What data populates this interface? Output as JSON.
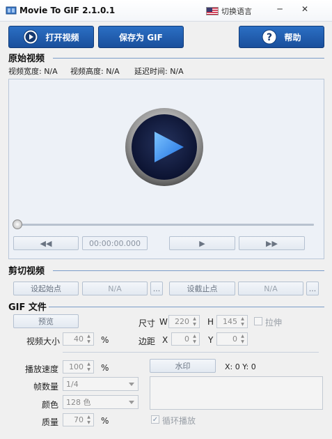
{
  "window": {
    "title": "Movie To GIF 2.1.0.1",
    "lang_button": "切换语言",
    "minimize": "─",
    "close": "✕"
  },
  "toolbar": {
    "open_video": "打开视频",
    "save_gif": "保存为 GIF",
    "help": "帮助"
  },
  "original": {
    "title": "原始视频",
    "width_label": "视频宽度: N/A",
    "height_label": "视频高度: N/A",
    "delay_label": "延迟时间: N/A",
    "time": "00:00:00.000",
    "rewind_icon": "rewind-icon",
    "play_icon": "play-icon",
    "forward_icon": "forward-icon"
  },
  "trim": {
    "title": "剪切视频",
    "set_start": "设起始点",
    "start_value": "N/A",
    "start_more": "...",
    "set_end": "设截止点",
    "end_value": "N/A",
    "end_more": "..."
  },
  "gif": {
    "title": "GIF 文件",
    "preview": "预览",
    "size_label": "尺寸",
    "w_label": "W",
    "w_value": "220",
    "h_label": "H",
    "h_value": "145",
    "stretch_label": "拉伸",
    "video_size_label": "视频大小",
    "video_size_value": "40",
    "percent": "%",
    "margin_label": "边距",
    "x_label": "X",
    "x_value": "0",
    "y_label": "Y",
    "y_value": "0",
    "speed_label": "播放速度",
    "speed_value": "100",
    "frames_label": "帧数量",
    "frames_value": "1/4",
    "color_label": "颜色",
    "color_value": "128 色",
    "quality_label": "质量",
    "quality_value": "70",
    "watermark": "水印",
    "coords": "X: 0  Y: 0",
    "loop_label": "循环播放"
  }
}
